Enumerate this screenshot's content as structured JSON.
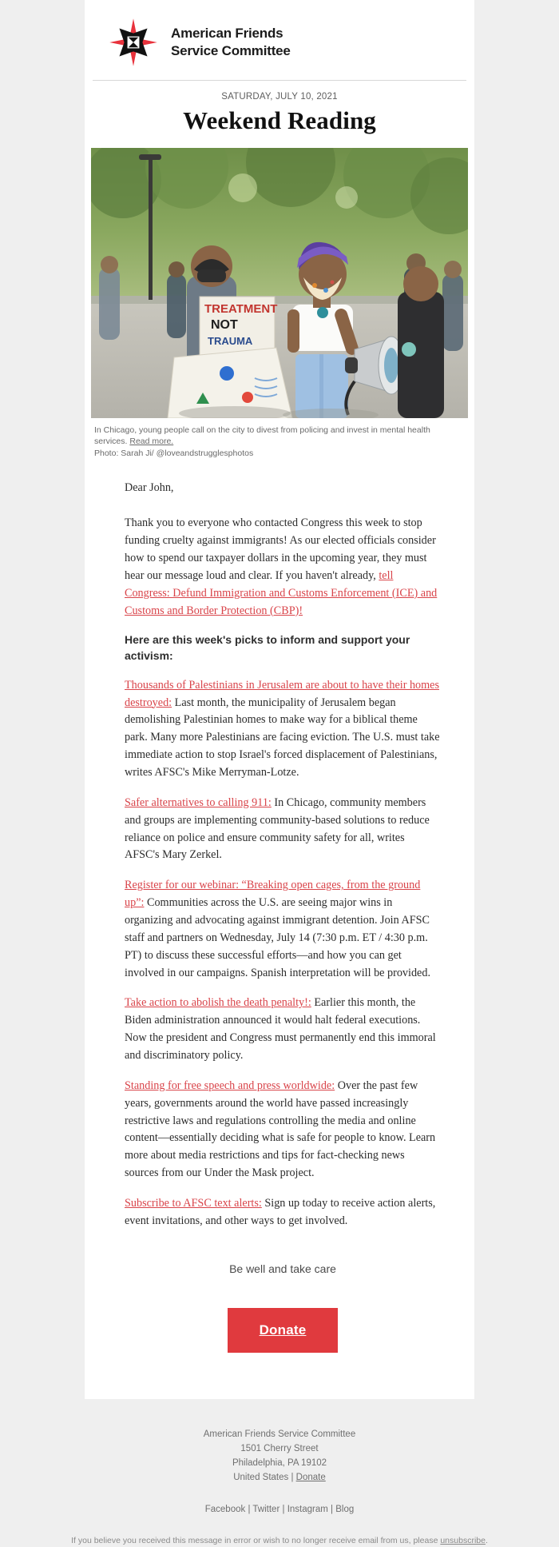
{
  "header": {
    "logo_icon": "afsc-star-logo",
    "org_line1": "American Friends",
    "org_line2": "Service Committee",
    "date": "SATURDAY, JULY 10, 2021",
    "masthead": "Weekend Reading"
  },
  "hero": {
    "alt": "protest-photo",
    "caption_text": "In Chicago, young people call on the city to divest from policing and invest in mental health services.",
    "caption_link": "Read more.",
    "photo_credit": "Photo: Sarah Ji/ @loveandstrugglesphotos"
  },
  "body": {
    "greeting": "Dear John,",
    "intro_part1": "Thank you to everyone who contacted Congress this week to stop funding cruelty against immigrants! As our elected officials consider how to spend our taxpayer dollars in the upcoming year, they must hear our message loud and clear. If you haven't already, ",
    "intro_link": "tell Congress: Defund Immigration and Customs Enforcement (ICE) and Customs and Border Protection (CBP)!",
    "picks_heading": "Here are this week's picks to inform and support your activism:",
    "items": [
      {
        "link": "Thousands of Palestinians in Jerusalem are about to have their homes destroyed:",
        "text": " Last month, the municipality of Jerusalem began demolishing Palestinian homes to make way for a biblical theme park. Many more Palestinians are facing eviction. The U.S. must take immediate action to stop Israel's forced displacement of Palestinians, writes AFSC's Mike Merryman-Lotze."
      },
      {
        "link": "Safer alternatives to calling 911:",
        "text": " In Chicago, community members and groups are implementing community-based solutions to reduce reliance on police and ensure community safety for all, writes AFSC's Mary Zerkel."
      },
      {
        "link": "Register for our webinar: “Breaking open cages, from the ground up”:",
        "text": "  Communities across the U.S. are seeing major wins in organizing and advocating against immigrant detention. Join AFSC staff and partners on Wednesday, July 14 (7:30 p.m. ET / 4:30 p.m. PT) to discuss these successful efforts—and how you can get involved in our campaigns. Spanish interpretation will be provided."
      },
      {
        "link": "Take action to abolish the death penalty!:",
        "text": "  Earlier this month, the Biden administration announced it would halt federal executions. Now the president and Congress must permanently end this immoral and discriminatory policy."
      },
      {
        "link": "Standing for free speech and press worldwide:",
        "text": " Over the past few years, governments around the world have passed increasingly restrictive laws and regulations controlling the media and online content—essentially deciding what is safe for people to know.  Learn more about media restrictions and tips for fact-checking news sources from our Under the Mask project."
      },
      {
        "link": "Subscribe to AFSC text alerts:",
        "text": "  Sign up today to receive action alerts, event invitations, and other ways to get involved."
      }
    ],
    "signoff": "Be well and take care",
    "donate_label": "Donate"
  },
  "footer": {
    "org": "American Friends Service Committee",
    "street": "1501 Cherry Street",
    "city": "Philadelphia, PA 19102",
    "country": "United States",
    "separator": " | ",
    "donate_link": "Donate",
    "social": [
      "Facebook",
      "Twitter",
      "Instagram",
      "Blog"
    ],
    "social_separator": " | ",
    "legal_before": "If you believe you received this message in error or wish to no longer receive email from us, please ",
    "legal_link": "unsubscribe",
    "legal_after": "."
  },
  "colors": {
    "accent_red": "#e03a3e",
    "link_red": "#d9444a",
    "page_bg": "#efefef",
    "card_bg": "#ffffff"
  }
}
